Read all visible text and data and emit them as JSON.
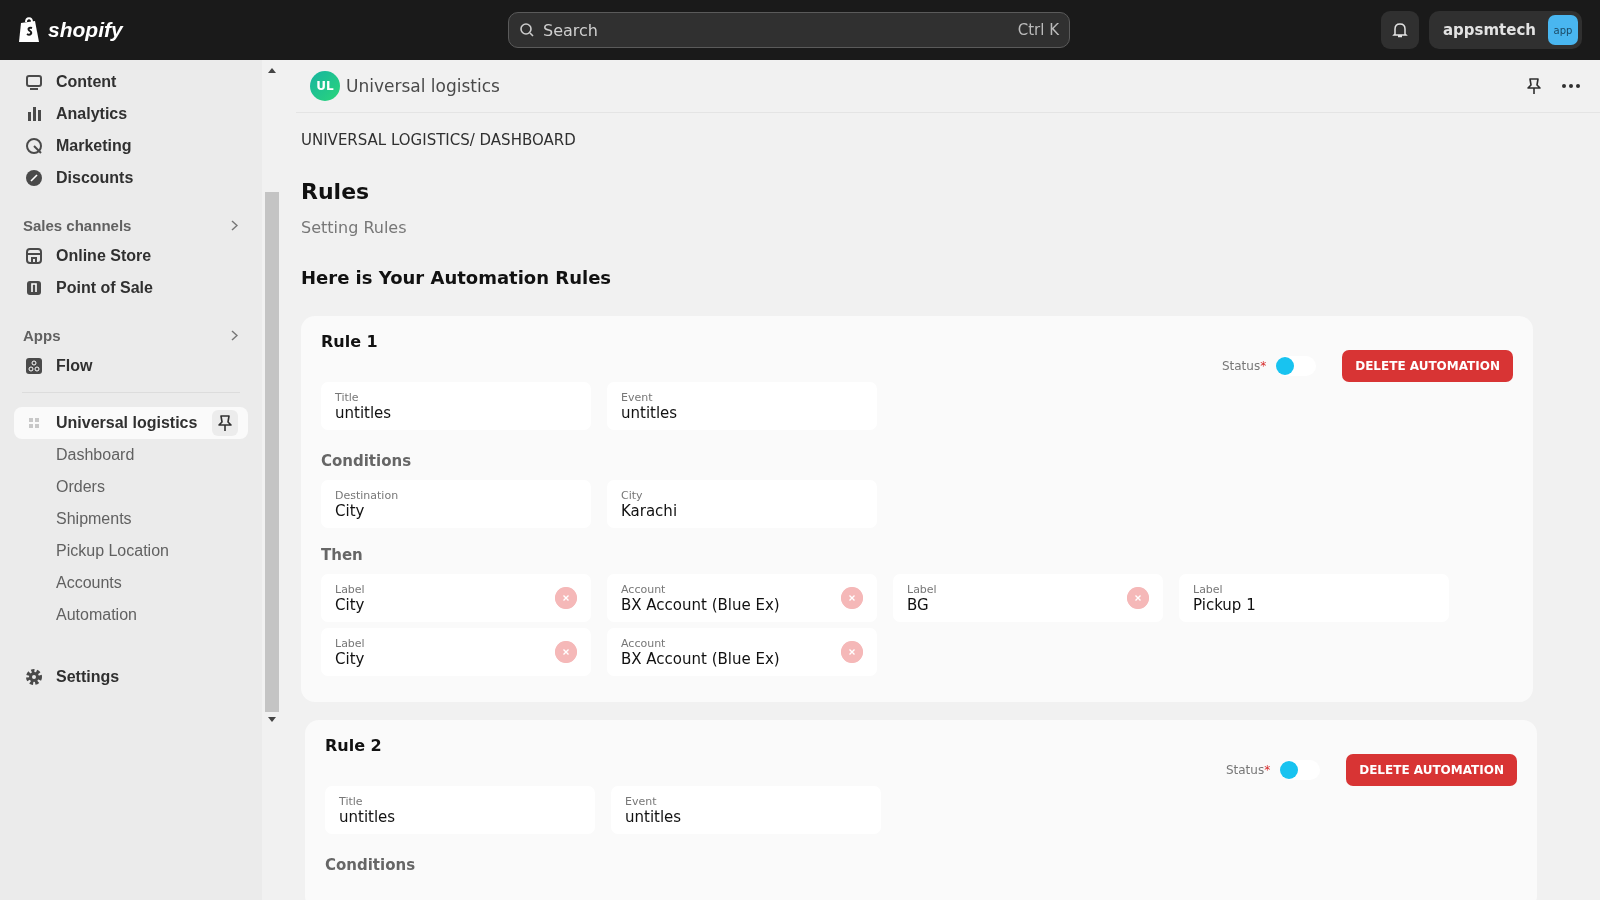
{
  "topbar": {
    "logo": "shopify",
    "search": {
      "placeholder": "Search",
      "shortcut": "Ctrl K"
    },
    "account": {
      "name": "appsmtech",
      "badge": "app"
    }
  },
  "sidebar": {
    "items": [
      {
        "label": "Content",
        "selected": false
      },
      {
        "label": "Analytics",
        "selected": false
      },
      {
        "label": "Marketing",
        "selected": false
      },
      {
        "label": "Discounts",
        "selected": false
      }
    ],
    "sections": [
      {
        "title": "Sales channels",
        "items": [
          {
            "label": "Online Store",
            "selected": false
          },
          {
            "label": "Point of Sale",
            "selected": false
          }
        ]
      },
      {
        "title": "Apps",
        "items": [
          {
            "label": "Flow",
            "selected": false
          }
        ]
      }
    ],
    "app": {
      "label": "Universal logistics",
      "selected": true,
      "children": [
        {
          "label": "Dashboard",
          "selected": false
        },
        {
          "label": "Orders",
          "selected": false
        },
        {
          "label": "Shipments",
          "selected": false
        },
        {
          "label": "Pickup Location",
          "selected": false
        },
        {
          "label": "Accounts",
          "selected": false
        },
        {
          "label": "Automation",
          "selected": false
        }
      ]
    },
    "settings": {
      "label": "Settings",
      "selected": false
    }
  },
  "app_header": {
    "avatar": "UL",
    "title": "Universal logistics"
  },
  "breadcrumb": "UNIVERSAL LOGISTICS/ DASHBOARD",
  "page_title": "Rules",
  "subtitle": "Setting Rules",
  "section_title": "Here is Your Automation Rules",
  "rules": [
    {
      "title": "Rule 1",
      "status_label": "Status",
      "required_mark": "*",
      "on": false,
      "delete_button": "DELETE AUTOMATION",
      "fields": [
        {
          "label": "Title",
          "value": "untitles"
        },
        {
          "label": "Event",
          "value": "untitles"
        }
      ],
      "conditions_title": "Conditions",
      "conditions": [
        {
          "label": "Destination",
          "value": "City"
        },
        {
          "label": "City",
          "value": "Karachi"
        }
      ],
      "then_title": "Then",
      "actions": [
        [
          {
            "label": "Label",
            "value": "City",
            "removable": true
          },
          {
            "label": "Account",
            "value": "BX Account (Blue Ex)",
            "removable": true
          },
          {
            "label": "Label",
            "value": "BG",
            "removable": true
          },
          {
            "label": "Label",
            "value": "Pickup 1",
            "removable": false
          }
        ],
        [
          {
            "label": "Label",
            "value": "City",
            "removable": true
          },
          {
            "label": "Account",
            "value": "BX Account (Blue Ex)",
            "removable": true
          }
        ]
      ]
    },
    {
      "title": "Rule 2",
      "status_label": "Status",
      "required_mark": "*",
      "on": false,
      "delete_button": "DELETE AUTOMATION",
      "fields": [
        {
          "label": "Title",
          "value": "untitles"
        },
        {
          "label": "Event",
          "value": "untitles"
        }
      ],
      "conditions_title": "Conditions"
    }
  ]
}
